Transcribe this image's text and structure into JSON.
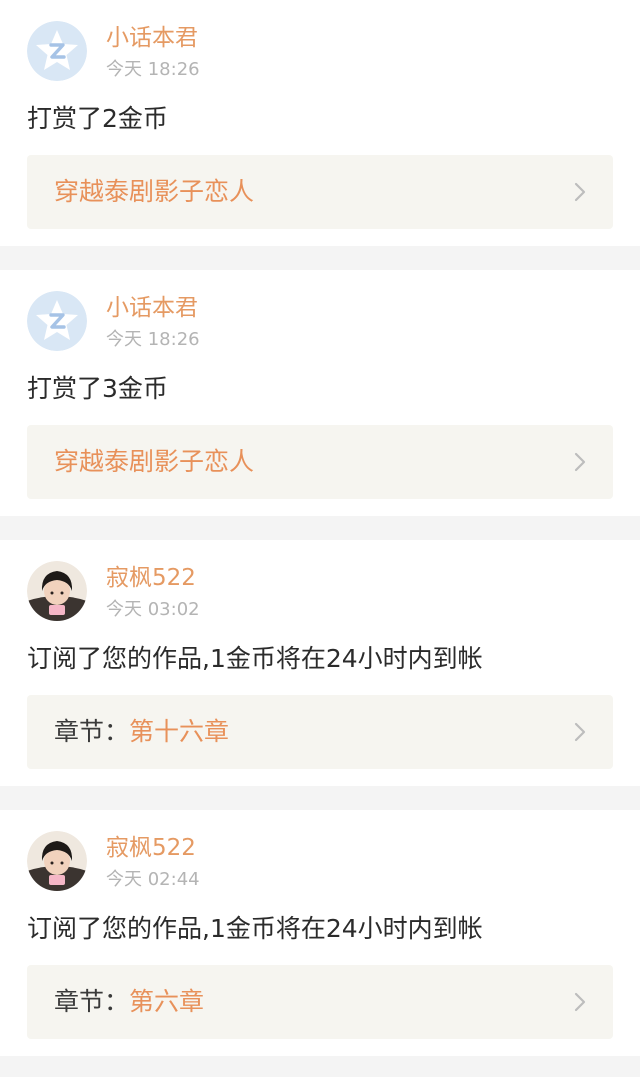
{
  "colors": {
    "accent": "#e59a63",
    "title_accent": "#e8915a",
    "timestamp": "#b4b4b4",
    "text": "#2b2b2b",
    "link_bg": "#f6f5f0",
    "page_bg": "#f4f4f4"
  },
  "notifications": [
    {
      "avatar_icon": "qq-reading-logo-icon",
      "username": "小话本君",
      "time": "今天 18:26",
      "message": "打赏了2金币",
      "link_prefix": "",
      "link_title": "穿越泰剧影子恋人"
    },
    {
      "avatar_icon": "qq-reading-logo-icon",
      "username": "小话本君",
      "time": "今天 18:26",
      "message": "打赏了3金币",
      "link_prefix": "",
      "link_title": "穿越泰剧影子恋人"
    },
    {
      "avatar_icon": "user-photo",
      "username": "寂枫522",
      "time": "今天 03:02",
      "message": "订阅了您的作品,1金币将在24小时内到帐",
      "link_prefix": "章节：",
      "link_title": "第十六章"
    },
    {
      "avatar_icon": "user-photo",
      "username": "寂枫522",
      "time": "今天 02:44",
      "message": "订阅了您的作品,1金币将在24小时内到帐",
      "link_prefix": "章节：",
      "link_title": "第六章"
    }
  ]
}
